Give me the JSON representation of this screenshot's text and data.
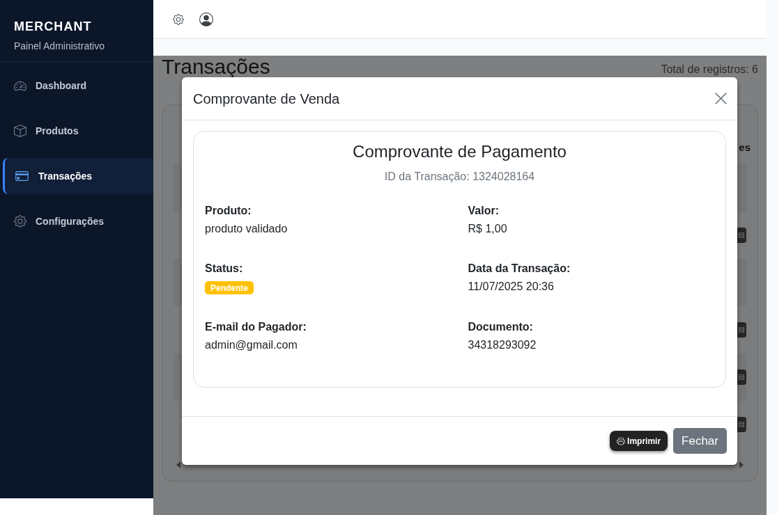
{
  "sidebar": {
    "brand": "MERCHANT",
    "subtitle": "Painel Administrativo",
    "items": [
      {
        "label": "Dashboard",
        "selected": false
      },
      {
        "label": "Produtos",
        "selected": false
      },
      {
        "label": "Transações",
        "selected": true
      },
      {
        "label": "Configurações",
        "selected": false
      }
    ]
  },
  "page": {
    "title": "Transações",
    "total": "Total de registros: 6",
    "table": {
      "header_fragment": "es",
      "rows": [
        {
          "action_button": false
        },
        {
          "action_button": true
        },
        {
          "action_button": false
        },
        {
          "action_button": true
        },
        {
          "action_button": true
        },
        {
          "action_button": true
        }
      ]
    }
  },
  "modal": {
    "title": "Comprovante de Venda",
    "receipt": {
      "heading": "Comprovante de Pagamento",
      "transaction_id": "ID da Transação: 1324028164",
      "fields": [
        {
          "label": "Produto:",
          "value": "produto validado",
          "kind": "text"
        },
        {
          "label": "Valor:",
          "value": "R$ 1,00",
          "kind": "text"
        },
        {
          "label": "Status:",
          "value": "Pendente",
          "kind": "badge",
          "color": "#ffc107"
        },
        {
          "label": "Data da Transação:",
          "value": "11/07/2025 20:36",
          "kind": "text"
        },
        {
          "label": "E-mail do Pagador:",
          "value": "admin@gmail.com",
          "kind": "text"
        },
        {
          "label": "Documento:",
          "value": "34318293092",
          "kind": "text"
        }
      ]
    },
    "buttons": [
      {
        "label": "Imprimir",
        "kind": "print"
      },
      {
        "label": "Fechar",
        "kind": "secondary"
      }
    ]
  }
}
